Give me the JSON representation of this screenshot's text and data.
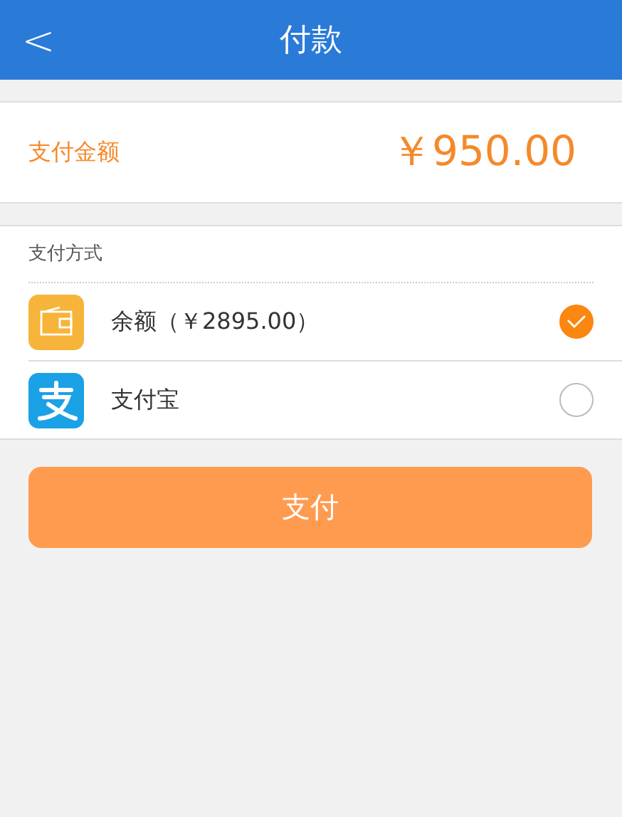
{
  "header": {
    "back": "<",
    "title": "付款"
  },
  "amount": {
    "label": "支付金额",
    "value": "￥950.00"
  },
  "methods": {
    "title": "支付方式",
    "options": [
      {
        "kind": "wallet",
        "label": "余额（￥2895.00）",
        "selected": true
      },
      {
        "kind": "alipay",
        "label": "支付宝",
        "selected": false
      }
    ]
  },
  "pay_button": "支付"
}
